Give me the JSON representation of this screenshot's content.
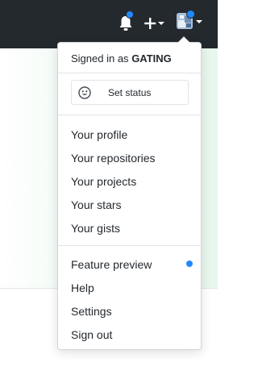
{
  "header": {
    "icons": [
      "bell-icon",
      "plus-icon",
      "avatar"
    ],
    "accent": "#2188ff",
    "background": "#24292e"
  },
  "dropdown": {
    "signed_in_prefix": "Signed in as",
    "username": "GATING",
    "set_status_label": "Set status",
    "items_group1": [
      "Your profile",
      "Your repositories",
      "Your projects",
      "Your stars",
      "Your gists"
    ],
    "items_group2": [
      "Feature preview",
      "Help",
      "Settings",
      "Sign out"
    ]
  }
}
